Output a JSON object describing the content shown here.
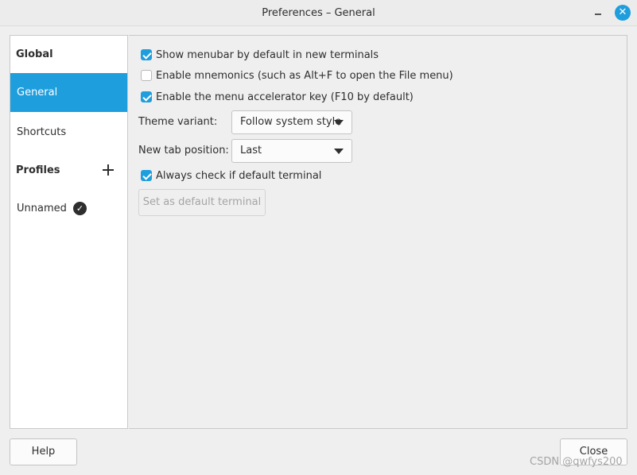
{
  "window": {
    "title": "Preferences – General",
    "minimize_icon": "minimize-icon",
    "close_icon": "close-icon",
    "accent_color": "#1f9ede"
  },
  "sidebar": {
    "global_heading": "Global",
    "items": [
      {
        "label": "General",
        "selected": true
      },
      {
        "label": "Shortcuts",
        "selected": false
      }
    ],
    "profiles_heading": "Profiles",
    "add_profile_icon": "plus-icon",
    "profiles": [
      {
        "label": "Unnamed",
        "default_icon": "check-circle-icon"
      }
    ]
  },
  "general": {
    "show_menubar": {
      "label": "Show menubar by default in new terminals",
      "checked": true
    },
    "enable_mnemonics": {
      "label": "Enable mnemonics (such as Alt+F to open the File menu)",
      "checked": false
    },
    "enable_accelerator": {
      "label": "Enable the menu accelerator key (F10 by default)",
      "checked": true
    },
    "theme_variant": {
      "label": "Theme variant:",
      "value": "Follow system style"
    },
    "new_tab_position": {
      "label": "New tab position:",
      "value": "Last"
    },
    "always_check_default": {
      "label": "Always check if default terminal",
      "checked": true
    },
    "set_default_button": "Set as default terminal"
  },
  "footer": {
    "help_button": "Help",
    "close_button": "Close"
  },
  "watermark": "CSDN @qwfys200"
}
